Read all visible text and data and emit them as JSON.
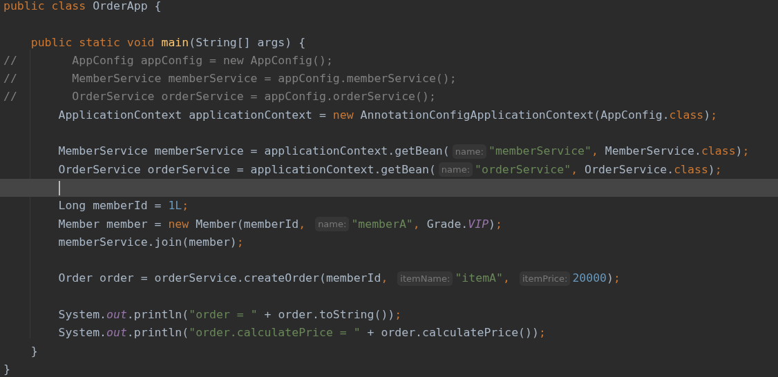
{
  "editor": {
    "lines": [
      {
        "current": false,
        "tokens": [
          {
            "kind": "keyword",
            "text": "public class"
          },
          {
            "kind": "plain",
            "text": " OrderApp {"
          }
        ]
      },
      {
        "current": false
      },
      {
        "current": false,
        "tokens": [
          {
            "kind": "keyword",
            "text": "    public static void"
          },
          {
            "kind": "method",
            "text": " main"
          },
          {
            "kind": "plain",
            "text": "(String[] args) {"
          }
        ]
      },
      {
        "current": false,
        "tokens": [
          {
            "kind": "comment",
            "text": "//        AppConfig appConfig = new AppConfig();"
          }
        ]
      },
      {
        "current": false,
        "tokens": [
          {
            "kind": "comment",
            "text": "//        MemberService memberService = appConfig.memberService();"
          }
        ]
      },
      {
        "current": false,
        "tokens": [
          {
            "kind": "comment",
            "text": "//        OrderService orderService = appConfig.orderService();"
          }
        ]
      },
      {
        "current": false,
        "tokens": [
          {
            "kind": "plain",
            "text": "        ApplicationContext applicationContext = "
          },
          {
            "kind": "keyword",
            "text": "new"
          },
          {
            "kind": "plain",
            "text": " AnnotationConfigApplicationContext(AppConfig."
          },
          {
            "kind": "keyword",
            "text": "class"
          },
          {
            "kind": "plain",
            "text": ")"
          },
          {
            "kind": "keyword",
            "text": ";"
          }
        ]
      },
      {
        "current": false
      },
      {
        "current": false,
        "tokens": [
          {
            "kind": "plain",
            "text": "        MemberService memberService = applicationContext.getBean("
          },
          {
            "kind": "hint",
            "text": "name:"
          },
          {
            "kind": "string",
            "text": "\"memberService\""
          },
          {
            "kind": "keyword",
            "text": ","
          },
          {
            "kind": "plain",
            "text": " MemberService."
          },
          {
            "kind": "keyword",
            "text": "class"
          },
          {
            "kind": "plain",
            "text": ")"
          },
          {
            "kind": "keyword",
            "text": ";"
          }
        ]
      },
      {
        "current": false,
        "tokens": [
          {
            "kind": "plain",
            "text": "        OrderService orderService = applicationContext.getBean("
          },
          {
            "kind": "hint",
            "text": "name:"
          },
          {
            "kind": "string",
            "text": "\"orderService\""
          },
          {
            "kind": "keyword",
            "text": ","
          },
          {
            "kind": "plain",
            "text": " OrderService."
          },
          {
            "kind": "keyword",
            "text": "class"
          },
          {
            "kind": "plain",
            "text": ")"
          },
          {
            "kind": "keyword",
            "text": ";"
          }
        ]
      },
      {
        "current": true
      },
      {
        "current": false,
        "tokens": [
          {
            "kind": "plain",
            "text": "        Long memberId = "
          },
          {
            "kind": "number",
            "text": "1L"
          },
          {
            "kind": "keyword",
            "text": ";"
          }
        ]
      },
      {
        "current": false,
        "tokens": [
          {
            "kind": "plain",
            "text": "        Member member = "
          },
          {
            "kind": "keyword",
            "text": "new"
          },
          {
            "kind": "plain",
            "text": " Member(memberId"
          },
          {
            "kind": "keyword",
            "text": ","
          },
          {
            "kind": "hint",
            "text": "name:"
          },
          {
            "kind": "string",
            "text": "\"memberA\""
          },
          {
            "kind": "keyword",
            "text": ","
          },
          {
            "kind": "plain",
            "text": " Grade."
          },
          {
            "kind": "field",
            "text": "VIP"
          },
          {
            "kind": "plain",
            "text": ")"
          },
          {
            "kind": "keyword",
            "text": ";"
          }
        ]
      },
      {
        "current": false,
        "tokens": [
          {
            "kind": "plain",
            "text": "        memberService.join(member)"
          },
          {
            "kind": "keyword",
            "text": ";"
          }
        ]
      },
      {
        "current": false
      },
      {
        "current": false,
        "tokens": [
          {
            "kind": "plain",
            "text": "        Order order = orderService.createOrder(memberId"
          },
          {
            "kind": "keyword",
            "text": ","
          },
          {
            "kind": "hint",
            "text": "itemName:"
          },
          {
            "kind": "string",
            "text": "\"itemA\""
          },
          {
            "kind": "keyword",
            "text": ","
          },
          {
            "kind": "hint",
            "text": "itemPrice:"
          },
          {
            "kind": "number",
            "text": "20000"
          },
          {
            "kind": "plain",
            "text": ")"
          },
          {
            "kind": "keyword",
            "text": ";"
          }
        ]
      },
      {
        "current": false
      },
      {
        "current": false,
        "tokens": [
          {
            "kind": "plain",
            "text": "        System."
          },
          {
            "kind": "field",
            "text": "out"
          },
          {
            "kind": "plain",
            "text": ".println("
          },
          {
            "kind": "string",
            "text": "\"order = \""
          },
          {
            "kind": "plain",
            "text": " + order.toString())"
          },
          {
            "kind": "keyword",
            "text": ";"
          }
        ]
      },
      {
        "current": false,
        "tokens": [
          {
            "kind": "plain",
            "text": "        System."
          },
          {
            "kind": "field",
            "text": "out"
          },
          {
            "kind": "plain",
            "text": ".println("
          },
          {
            "kind": "string",
            "text": "\"order.calculatePrice = \""
          },
          {
            "kind": "plain",
            "text": " + order.calculatePrice())"
          },
          {
            "kind": "keyword",
            "text": ";"
          }
        ]
      },
      {
        "current": false,
        "tokens": [
          {
            "kind": "plain",
            "text": "    }"
          }
        ]
      },
      {
        "current": false,
        "tokens": [
          {
            "kind": "plain",
            "text": "}"
          }
        ]
      }
    ]
  }
}
